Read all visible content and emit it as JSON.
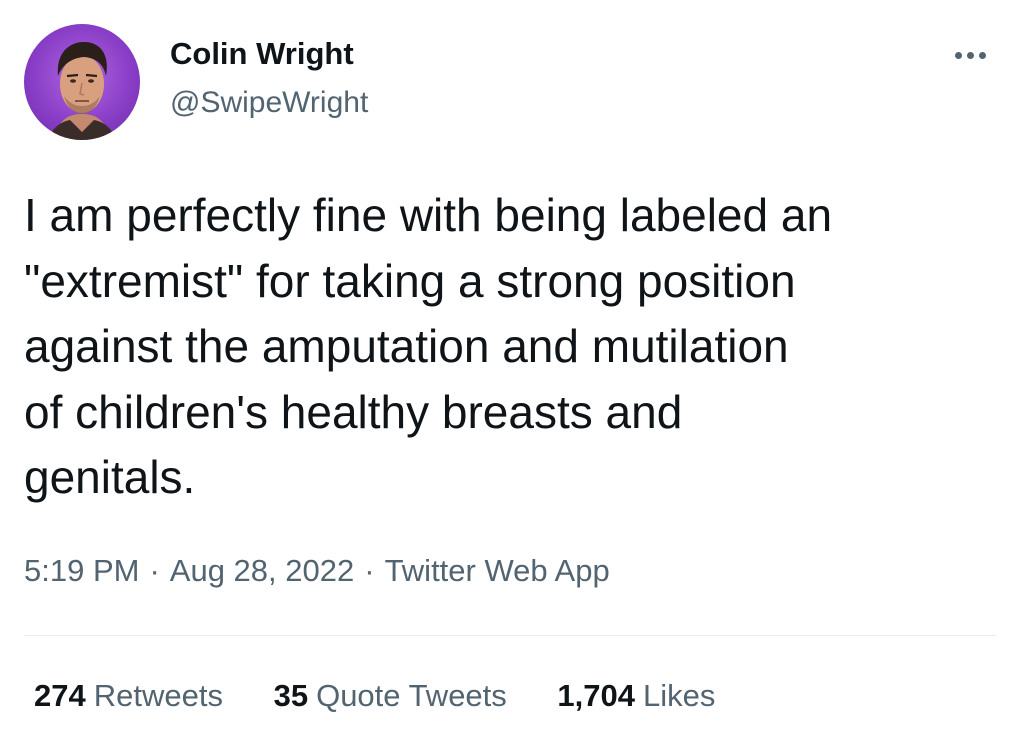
{
  "user": {
    "display_name": "Colin Wright",
    "handle": "@SwipeWright",
    "avatar_background": "#8a3fc8"
  },
  "tweet": {
    "lines": [
      "I am perfectly fine with being labeled an",
      "\"extremist\" for taking a strong position",
      "against the amputation and mutilation",
      "of children's healthy breasts and",
      "genitals."
    ],
    "time": "5:19 PM",
    "separator": "·",
    "date": "Aug 28, 2022",
    "source": "Twitter Web App"
  },
  "stats": {
    "retweets": {
      "count": "274",
      "label": "Retweets"
    },
    "quotes": {
      "count": "35",
      "label": "Quote Tweets"
    },
    "likes": {
      "count": "1,704",
      "label": "Likes"
    }
  },
  "icons": {
    "more": "more-horizontal-icon"
  },
  "colors": {
    "text_primary": "#0f1419",
    "text_secondary": "#536471",
    "divider": "#e6ecf0"
  }
}
